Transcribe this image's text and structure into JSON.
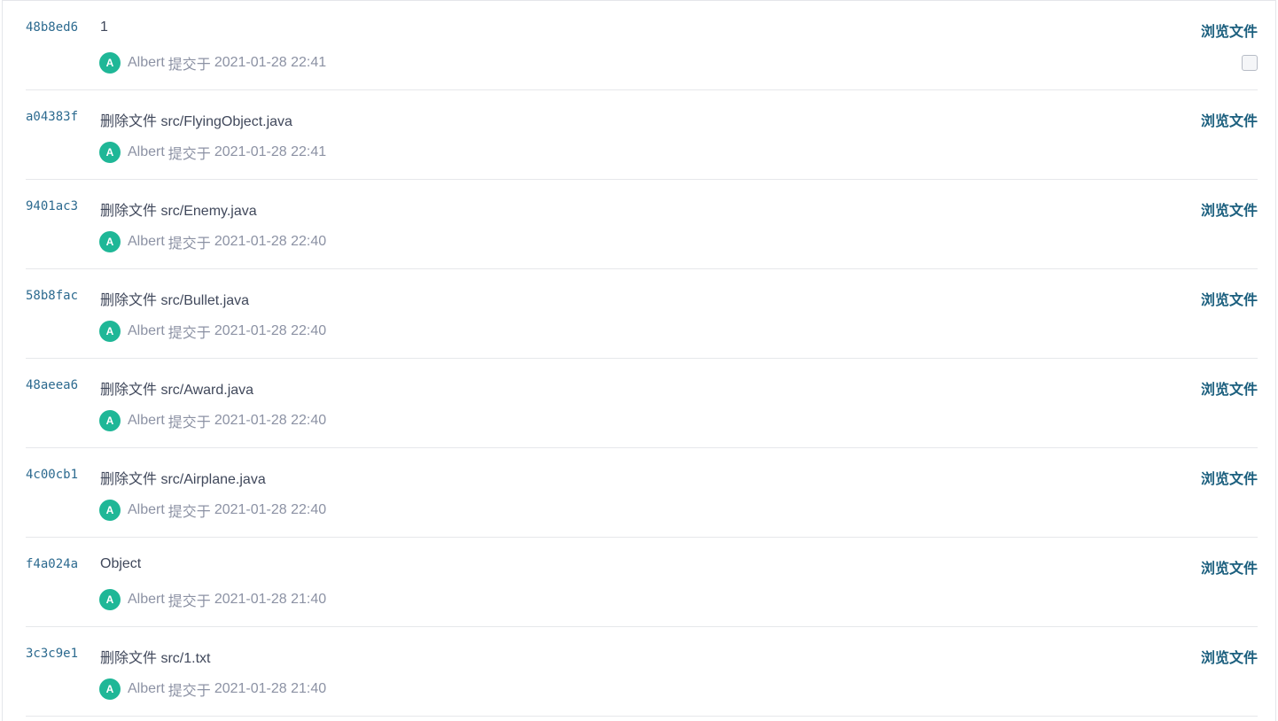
{
  "browse_label": "浏览文件",
  "committed_label": "提交于",
  "avatar_color": "#1fb797",
  "link_color": "#1b5f7e",
  "commits": [
    {
      "sha": "48b8ed6",
      "message": "1",
      "author": "Albert",
      "avatar_letter": "A",
      "date": "2021-01-28 22:41",
      "has_checkbox": true
    },
    {
      "sha": "a04383f",
      "message": "删除文件 src/FlyingObject.java",
      "author": "Albert",
      "avatar_letter": "A",
      "date": "2021-01-28 22:41"
    },
    {
      "sha": "9401ac3",
      "message": "删除文件 src/Enemy.java",
      "author": "Albert",
      "avatar_letter": "A",
      "date": "2021-01-28 22:40"
    },
    {
      "sha": "58b8fac",
      "message": "删除文件 src/Bullet.java",
      "author": "Albert",
      "avatar_letter": "A",
      "date": "2021-01-28 22:40"
    },
    {
      "sha": "48aeea6",
      "message": "删除文件 src/Award.java",
      "author": "Albert",
      "avatar_letter": "A",
      "date": "2021-01-28 22:40"
    },
    {
      "sha": "4c00cb1",
      "message": "删除文件 src/Airplane.java",
      "author": "Albert",
      "avatar_letter": "A",
      "date": "2021-01-28 22:40"
    },
    {
      "sha": "f4a024a",
      "message": "Object",
      "author": "Albert",
      "avatar_letter": "A",
      "date": "2021-01-28 21:40"
    },
    {
      "sha": "3c3c9e1",
      "message": "删除文件 src/1.txt",
      "author": "Albert",
      "avatar_letter": "A",
      "date": "2021-01-28 21:40"
    }
  ]
}
